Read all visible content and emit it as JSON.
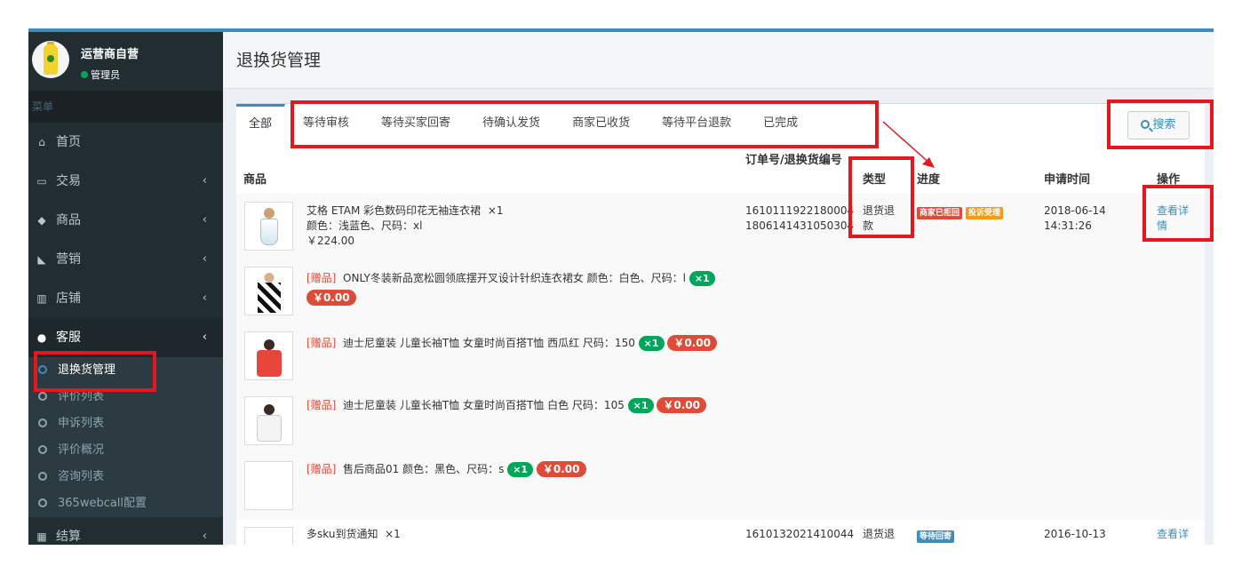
{
  "sidebar": {
    "user_name": "运营商自营",
    "user_role": "管理员",
    "menu_header": "菜单",
    "items": [
      {
        "label": "首页",
        "icon": "home-icon",
        "chevron": ""
      },
      {
        "label": "交易",
        "icon": "card-icon",
        "chevron": "‹"
      },
      {
        "label": "商品",
        "icon": "cube-icon",
        "chevron": "‹"
      },
      {
        "label": "营销",
        "icon": "tags-icon",
        "chevron": "‹"
      },
      {
        "label": "店铺",
        "icon": "building-icon",
        "chevron": "‹"
      },
      {
        "label": "客服",
        "icon": "comments-icon",
        "chevron": "‹"
      }
    ],
    "subitems": [
      {
        "label": "退换货管理"
      },
      {
        "label": "评价列表"
      },
      {
        "label": "申诉列表"
      },
      {
        "label": "评价概况"
      },
      {
        "label": "咨询列表"
      },
      {
        "label": "365webcall配置"
      }
    ],
    "last_item": {
      "label": "结算",
      "icon": "calculator-icon",
      "chevron": "‹"
    }
  },
  "page_title": "退换货管理",
  "tabs": [
    "全部",
    "等待审核",
    "等待买家回寄",
    "待确认发货",
    "商家已收货",
    "等待平台退款",
    "已完成"
  ],
  "search_label": "搜索",
  "columns": {
    "product": "商品",
    "order_no": "订单号/退换货编号",
    "type": "类型",
    "progress": "进度",
    "apply_time": "申请时间",
    "action": "操作"
  },
  "orders": [
    {
      "main_product": {
        "name": "艾格 ETAM 彩色数码印花无袖连衣裙",
        "qty": "×1",
        "spec": "颜色：浅蓝色、尺码：xl",
        "price": "￥224.00"
      },
      "gifts": [
        {
          "gift_tag": "[赠品]",
          "name": "ONLY冬装新品宽松圆领底摆开叉设计针织连衣裙女 颜色：白色、尺码：l",
          "qty": "×1",
          "price": "￥0.00"
        },
        {
          "gift_tag": "[赠品]",
          "name": "迪士尼童装 儿童长袖T恤 女童时尚百搭T恤 西瓜红 尺码：150",
          "qty": "×1",
          "price": "￥0.00"
        },
        {
          "gift_tag": "[赠品]",
          "name": "迪士尼童装 儿童长袖T恤 女童时尚百搭T恤 白色 尺码：105",
          "qty": "×1",
          "price": "￥0.00"
        },
        {
          "gift_tag": "[赠品]",
          "name": "售后商品01 颜色：黑色、尺码：s",
          "qty": "×1",
          "price": "￥0.00"
        }
      ],
      "order_no": "1610111922180004",
      "refund_no": "1806141431050304",
      "type": "退货退款",
      "progress": [
        {
          "label": "商家已拒回",
          "color": "#dd4b39"
        },
        {
          "label": "投诉受理",
          "color": "#f39c12"
        }
      ],
      "apply_date": "2018-06-14",
      "apply_time": "14:31:26",
      "action": "查看详情"
    },
    {
      "main_product": {
        "name": "多sku到货通知",
        "qty": "×1"
      },
      "order_no": "1610132021410044",
      "type": "退货退",
      "progress": [
        {
          "label": "等待回寄",
          "color": "#3c8dbc"
        }
      ],
      "apply_date": "2016-10-13",
      "action": "查看详"
    }
  ]
}
